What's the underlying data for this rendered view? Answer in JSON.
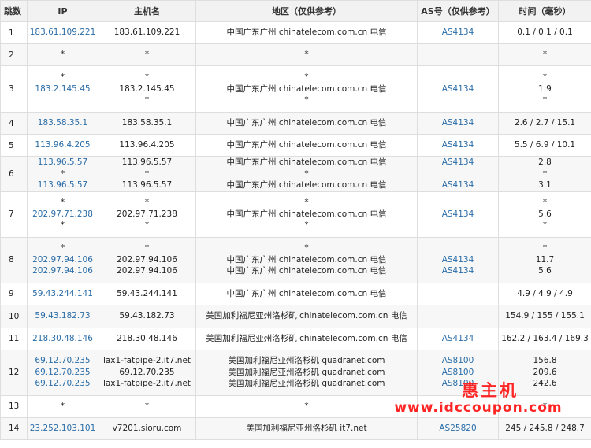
{
  "headers": {
    "hop": "跳数",
    "ip": "IP",
    "host": "主机名",
    "location": "地区（仅供参考）",
    "as": "AS号（仅供参考）",
    "time": "时间（毫秒）"
  },
  "rows": [
    {
      "hop": "1",
      "ip": [
        "183.61.109.221"
      ],
      "host": [
        "183.61.109.221"
      ],
      "location": [
        "中国广东广州 chinatelecom.com.cn 电信"
      ],
      "as": [
        "AS4134"
      ],
      "time": [
        "0.1 / 0.1 / 0.1"
      ]
    },
    {
      "hop": "2",
      "ip": [
        "*"
      ],
      "host": [
        "*"
      ],
      "location": [
        "*"
      ],
      "as": [
        ""
      ],
      "time": [
        "*"
      ]
    },
    {
      "hop": "3",
      "ip": [
        "*",
        "183.2.145.45",
        ""
      ],
      "host": [
        "*",
        "183.2.145.45",
        "*"
      ],
      "location": [
        "*",
        "中国广东广州 chinatelecom.com.cn 电信",
        "*"
      ],
      "as": [
        "",
        "AS4134",
        ""
      ],
      "time": [
        "*",
        "1.9",
        "*"
      ]
    },
    {
      "hop": "4",
      "ip": [
        "183.58.35.1"
      ],
      "host": [
        "183.58.35.1"
      ],
      "location": [
        "中国广东广州 chinatelecom.com.cn 电信"
      ],
      "as": [
        "AS4134"
      ],
      "time": [
        "2.6 / 2.7 / 15.1"
      ]
    },
    {
      "hop": "5",
      "ip": [
        "113.96.4.205"
      ],
      "host": [
        "113.96.4.205"
      ],
      "location": [
        "中国广东广州 chinatelecom.com.cn 电信"
      ],
      "as": [
        "AS4134"
      ],
      "time": [
        "5.5 / 6.9 / 10.1"
      ]
    },
    {
      "hop": "6",
      "ip": [
        "113.96.5.57",
        "*",
        "113.96.5.57"
      ],
      "host": [
        "113.96.5.57",
        "*",
        "113.96.5.57"
      ],
      "location": [
        "中国广东广州 chinatelecom.com.cn 电信",
        "*",
        "中国广东广州 chinatelecom.com.cn 电信"
      ],
      "as": [
        "AS4134",
        "",
        "AS4134"
      ],
      "time": [
        "2.8",
        "*",
        "3.1"
      ]
    },
    {
      "hop": "7",
      "ip": [
        "*",
        "202.97.71.238",
        "*"
      ],
      "host": [
        "*",
        "202.97.71.238",
        "*"
      ],
      "location": [
        "*",
        "中国广东广州 chinatelecom.com.cn 电信",
        "*"
      ],
      "as": [
        "",
        "AS4134",
        ""
      ],
      "time": [
        "*",
        "5.6",
        "*"
      ]
    },
    {
      "hop": "8",
      "ip": [
        "*",
        "202.97.94.106",
        "202.97.94.106"
      ],
      "host": [
        "*",
        "202.97.94.106",
        "202.97.94.106"
      ],
      "location": [
        "*",
        "中国广东广州 chinatelecom.com.cn 电信",
        "中国广东广州 chinatelecom.com.cn 电信"
      ],
      "as": [
        "",
        "AS4134",
        "AS4134"
      ],
      "time": [
        "*",
        "11.7",
        "5.6"
      ]
    },
    {
      "hop": "9",
      "ip": [
        "59.43.244.141"
      ],
      "host": [
        "59.43.244.141"
      ],
      "location": [
        "中国广东广州 chinatelecom.com.cn 电信"
      ],
      "as": [
        ""
      ],
      "time": [
        "4.9 / 4.9 / 4.9"
      ]
    },
    {
      "hop": "10",
      "ip": [
        "59.43.182.73"
      ],
      "host": [
        "59.43.182.73"
      ],
      "location": [
        "美国加利福尼亚州洛杉矶 chinatelecom.com.cn 电信"
      ],
      "as": [
        ""
      ],
      "time": [
        "154.9 / 155 / 155.1"
      ]
    },
    {
      "hop": "11",
      "ip": [
        "218.30.48.146"
      ],
      "host": [
        "218.30.48.146"
      ],
      "location": [
        "美国加利福尼亚州洛杉矶 chinatelecom.com.cn 电信"
      ],
      "as": [
        "AS4134"
      ],
      "time": [
        "162.2 / 163.4 / 169.3"
      ]
    },
    {
      "hop": "12",
      "ip": [
        "69.12.70.235",
        "69.12.70.235",
        "69.12.70.235"
      ],
      "host": [
        "lax1-fatpipe-2.it7.net",
        "69.12.70.235",
        "lax1-fatpipe-2.it7.net"
      ],
      "location": [
        "美国加利福尼亚州洛杉矶 quadranet.com",
        "美国加利福尼亚州洛杉矶 quadranet.com",
        "美国加利福尼亚州洛杉矶 quadranet.com"
      ],
      "as": [
        "AS8100",
        "AS8100",
        "AS8100"
      ],
      "time": [
        "156.8",
        "209.6",
        "242.6"
      ]
    },
    {
      "hop": "13",
      "ip": [
        "*"
      ],
      "host": [
        "*"
      ],
      "location": [
        "*"
      ],
      "as": [
        ""
      ],
      "time": [
        "*"
      ]
    },
    {
      "hop": "14",
      "ip": [
        "23.252.103.101"
      ],
      "host": [
        "v7201.sioru.com"
      ],
      "location": [
        "美国加利福尼亚州洛杉矶 it7.net"
      ],
      "as": [
        "AS25820"
      ],
      "time": [
        "245 / 245.8 / 248.7"
      ]
    }
  ],
  "watermark": {
    "text_cn": "惠主机",
    "url": "www.idccoupon.com"
  },
  "colors": {
    "link": "#2a6da8",
    "header_bg": "#f2f2f2",
    "alt_row_bg": "#f7f7f7",
    "border": "#dedede",
    "watermark": "#ff1a1a"
  }
}
